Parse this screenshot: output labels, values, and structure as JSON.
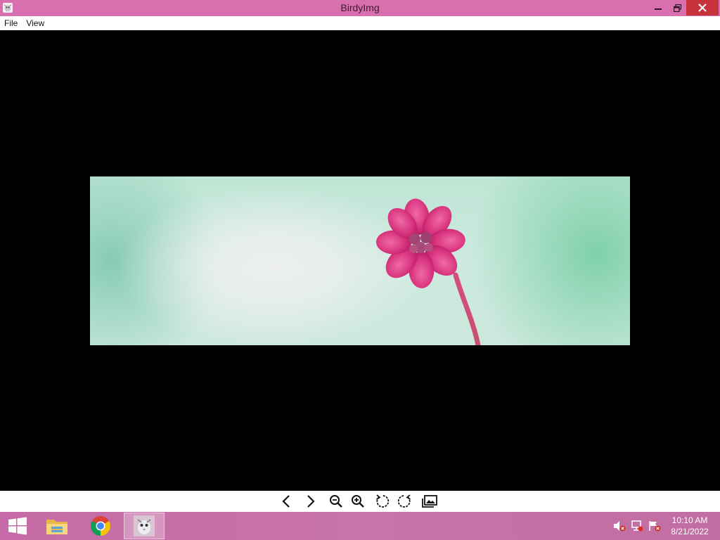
{
  "window": {
    "title": "BirdyImg",
    "app_icon": "birdyimg-logo-icon",
    "controls": [
      "minimize-icon",
      "restore-icon",
      "close-icon"
    ],
    "close_color": "#c7333a",
    "titlebar_color": "#d96faf"
  },
  "menu": {
    "items": [
      {
        "label": "File"
      },
      {
        "label": "View"
      }
    ]
  },
  "viewer": {
    "background": "#000000",
    "image_subject": "pink-flower-photo"
  },
  "toolbar": {
    "tools": [
      {
        "icon": "previous-icon"
      },
      {
        "icon": "next-icon"
      },
      {
        "icon": "zoom-out-icon"
      },
      {
        "icon": "zoom-in-icon"
      },
      {
        "icon": "rotate-left-icon"
      },
      {
        "icon": "rotate-right-icon"
      },
      {
        "icon": "gallery-icon"
      }
    ]
  },
  "taskbar": {
    "start_icon": "windows-start-icon",
    "apps": [
      {
        "icon": "file-explorer-icon"
      },
      {
        "icon": "chrome-icon"
      },
      {
        "icon": "birdyimg-icon",
        "active": true
      }
    ],
    "tray": [
      "volume-muted-icon",
      "network-icon",
      "action-center-icon"
    ],
    "clock": {
      "time": "10:10 AM",
      "date": "8/21/2022"
    }
  }
}
